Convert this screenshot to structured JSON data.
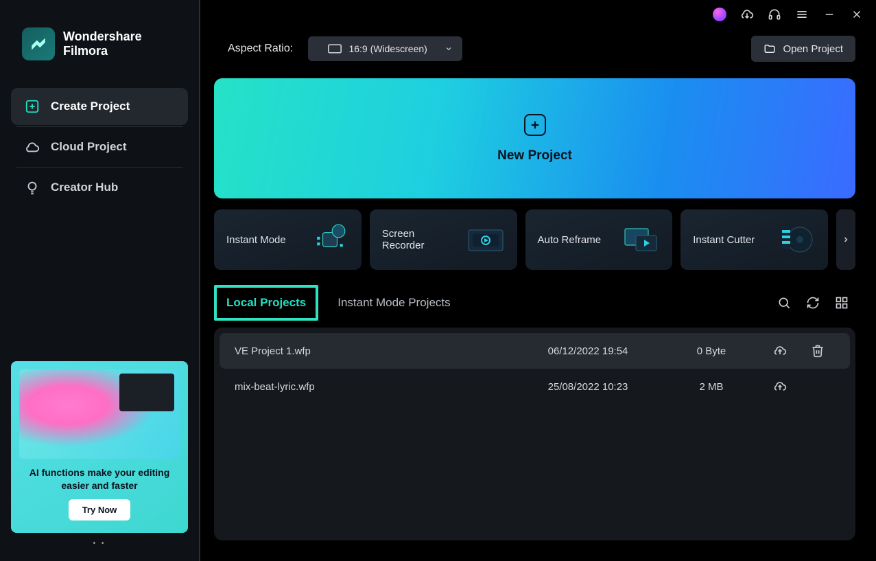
{
  "app": {
    "brand_line1": "Wondershare",
    "brand_line2": "Filmora"
  },
  "sidebar": {
    "items": [
      {
        "label": "Create Project"
      },
      {
        "label": "Cloud Project"
      },
      {
        "label": "Creator Hub"
      }
    ],
    "promo": {
      "headline": "AI functions make your editing easier and faster",
      "cta": "Try Now"
    }
  },
  "toolbar": {
    "aspect_label": "Aspect Ratio:",
    "aspect_value": "16:9 (Widescreen)",
    "open_project": "Open Project"
  },
  "new_project": {
    "label": "New Project"
  },
  "modes": [
    {
      "label": "Instant Mode"
    },
    {
      "label": "Screen Recorder"
    },
    {
      "label": "Auto Reframe"
    },
    {
      "label": "Instant Cutter"
    }
  ],
  "tabs": [
    {
      "label": "Local Projects"
    },
    {
      "label": "Instant Mode Projects"
    }
  ],
  "projects": [
    {
      "name": "VE Project 1.wfp",
      "date": "06/12/2022 19:54",
      "size": "0 Byte",
      "highlight": true,
      "trash": true
    },
    {
      "name": "mix-beat-lyric.wfp",
      "date": "25/08/2022 10:23",
      "size": "2 MB",
      "highlight": false,
      "trash": false
    }
  ]
}
